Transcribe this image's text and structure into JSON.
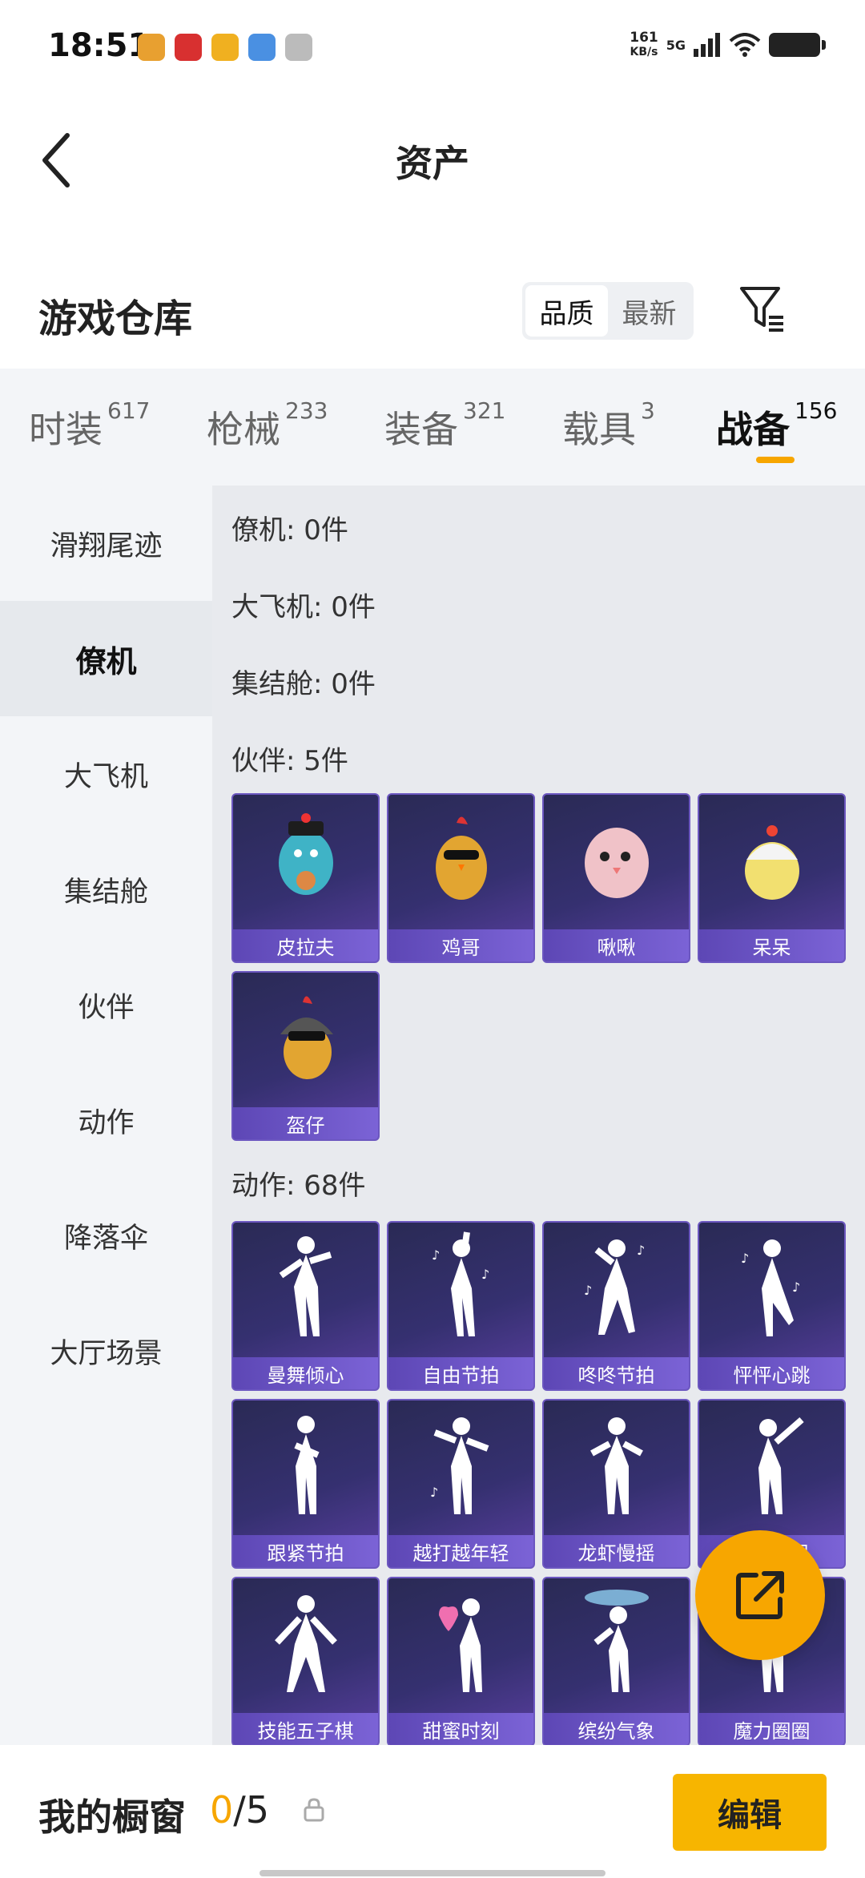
{
  "status_bar": {
    "time": "18:51",
    "net_speed_value": "161",
    "net_speed_unit": "KB/s",
    "network": "5G",
    "app_icon_colors": [
      "#e8a030",
      "#d83030",
      "#f0b020",
      "#4a90e2",
      "#bbbbbb"
    ]
  },
  "header": {
    "title": "资产"
  },
  "section": {
    "title": "游戏仓库",
    "sort_quality": "品质",
    "sort_newest": "最新"
  },
  "tabs": [
    {
      "label": "时装",
      "count": "617"
    },
    {
      "label": "枪械",
      "count": "233"
    },
    {
      "label": "装备",
      "count": "321"
    },
    {
      "label": "载具",
      "count": "3"
    },
    {
      "label": "战备",
      "count": "156",
      "active": true
    }
  ],
  "sidebar": {
    "items": [
      {
        "label": "滑翔尾迹"
      },
      {
        "label": "僚机",
        "active": true
      },
      {
        "label": "大飞机"
      },
      {
        "label": "集结舱"
      },
      {
        "label": "伙伴"
      },
      {
        "label": "动作"
      },
      {
        "label": "降落伞"
      },
      {
        "label": "大厅场景"
      }
    ]
  },
  "content": {
    "groups": [
      {
        "label": "僚机: 0件"
      },
      {
        "label": "大飞机: 0件"
      },
      {
        "label": "集结舱: 0件"
      },
      {
        "label": "伙伴: 5件"
      },
      {
        "label": "动作: 68件"
      }
    ],
    "partners": [
      "皮拉夫",
      "鸡哥",
      "啾啾",
      "呆呆",
      "盔仔"
    ],
    "actions": [
      "曼舞倾心",
      "自由节拍",
      "咚咚节拍",
      "怦怦心跳",
      "跟紧节拍",
      "越打越年轻",
      "龙虾慢摇",
      "律动飓风",
      "技能五子棋",
      "甜蜜时刻",
      "缤纷气象",
      "魔力圈圈"
    ]
  },
  "bottom": {
    "title": "我的橱窗",
    "count_current": "0",
    "count_total": "/5",
    "edit_label": "编辑"
  },
  "colors": {
    "accent": "#f7a600",
    "card_bg": "#353070",
    "card_label": "#6c57c0"
  }
}
